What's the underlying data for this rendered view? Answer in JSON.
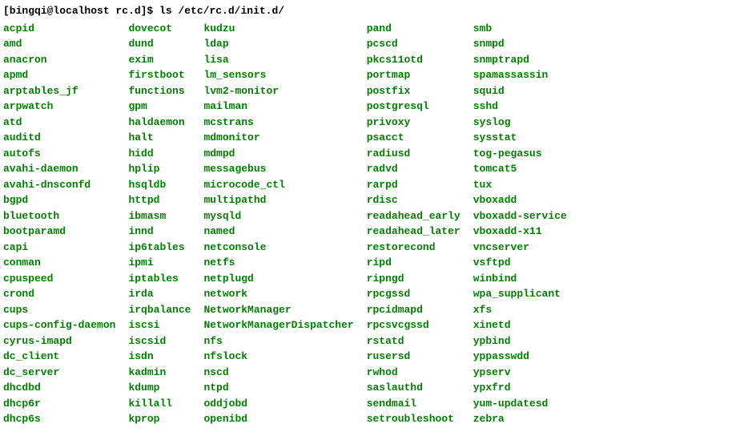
{
  "prompt": "[bingqi@localhost rc.d]$ ",
  "command": "ls /etc/rc.d/init.d/",
  "cols": [
    [
      "acpid",
      "amd",
      "anacron",
      "apmd",
      "arptables_jf",
      "arpwatch",
      "atd",
      "auditd",
      "autofs",
      "avahi-daemon",
      "avahi-dnsconfd",
      "bgpd",
      "bluetooth",
      "bootparamd",
      "capi",
      "conman",
      "cpuspeed",
      "crond",
      "cups",
      "cups-config-daemon",
      "cyrus-imapd",
      "dc_client",
      "dc_server",
      "dhcdbd",
      "dhcp6r",
      "dhcp6s"
    ],
    [
      "dovecot",
      "dund",
      "exim",
      "firstboot",
      "functions",
      "gpm",
      "haldaemon",
      "halt",
      "hidd",
      "hplip",
      "hsqldb",
      "httpd",
      "ibmasm",
      "innd",
      "ip6tables",
      "ipmi",
      "iptables",
      "irda",
      "irqbalance",
      "iscsi",
      "iscsid",
      "isdn",
      "kadmin",
      "kdump",
      "killall",
      "kprop"
    ],
    [
      "kudzu",
      "ldap",
      "lisa",
      "lm_sensors",
      "lvm2-monitor",
      "mailman",
      "mcstrans",
      "mdmonitor",
      "mdmpd",
      "messagebus",
      "microcode_ctl",
      "multipathd",
      "mysqld",
      "named",
      "netconsole",
      "netfs",
      "netplugd",
      "network",
      "NetworkManager",
      "NetworkManagerDispatcher",
      "nfs",
      "nfslock",
      "nscd",
      "ntpd",
      "oddjobd",
      "openibd"
    ],
    [
      "pand",
      "pcscd",
      "pkcs11otd",
      "portmap",
      "postfix",
      "postgresql",
      "privoxy",
      "psacct",
      "radiusd",
      "radvd",
      "rarpd",
      "rdisc",
      "readahead_early",
      "readahead_later",
      "restorecond",
      "ripd",
      "ripngd",
      "rpcgssd",
      "rpcidmapd",
      "rpcsvcgssd",
      "rstatd",
      "rusersd",
      "rwhod",
      "saslauthd",
      "sendmail",
      "setroubleshoot"
    ],
    [
      "smb",
      "snmpd",
      "snmptrapd",
      "spamassassin",
      "squid",
      "sshd",
      "syslog",
      "sysstat",
      "tog-pegasus",
      "tomcat5",
      "tux",
      "vboxadd",
      "vboxadd-service",
      "vboxadd-x11",
      "vncserver",
      "vsftpd",
      "winbind",
      "wpa_supplicant",
      "xfs",
      "xinetd",
      "ypbind",
      "yppasswdd",
      "ypserv",
      "ypxfrd",
      "yum-updatesd",
      "zebra"
    ]
  ]
}
